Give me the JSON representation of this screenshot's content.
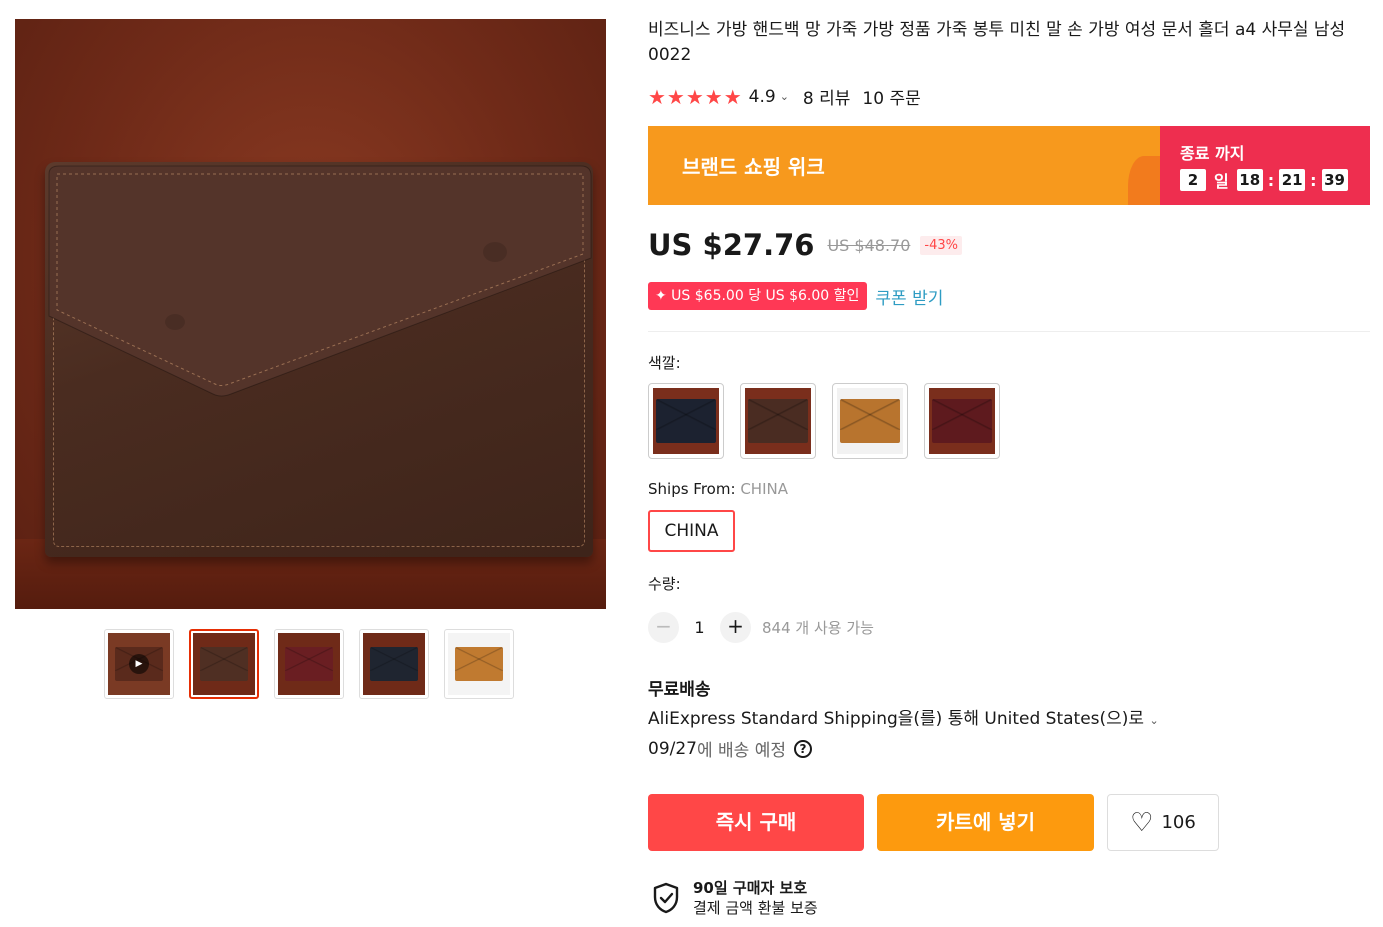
{
  "gallery": {
    "main_image_alt": "brown leather envelope document holder",
    "thumbnails": [
      {
        "name": "video",
        "color": "#7a3a24",
        "has_play": true
      },
      {
        "name": "brown",
        "color": "#4f2f23",
        "active": true
      },
      {
        "name": "wine",
        "color": "#6a1e22"
      },
      {
        "name": "navy",
        "color": "#1f2530"
      },
      {
        "name": "tan",
        "color": "#c07a30"
      }
    ],
    "play_icon": "▶"
  },
  "product": {
    "title": "비즈니스 가방 핸드백 망 가죽 가방 정품 가죽 봉투 미친 말 손 가방 여성 문서 홀더 a4 사무실 남성 0022",
    "stars": "★★★★★",
    "rating": "4.9",
    "rating_chevron": "⌄",
    "reviews": "8 리뷰",
    "orders": "10 주문"
  },
  "promo": {
    "label": "브랜드 쇼핑 위크",
    "timer_label": "종료 까지",
    "days": "2",
    "days_unit": "일",
    "hours": "18",
    "minutes": "21",
    "seconds": "39",
    "colon": ":"
  },
  "pricing": {
    "price": "US $27.76",
    "original_price": "US $48.70",
    "discount": "-43%",
    "coupon": "✦ US $65.00 당 US $6.00 할인",
    "coupon_action": "쿠폰 받기"
  },
  "options": {
    "color_label": "색깔:",
    "colors": [
      {
        "name": "navy",
        "hex": "#1c2230"
      },
      {
        "name": "brown",
        "hex": "#4a2c22"
      },
      {
        "name": "tan",
        "hex": "#b8742e"
      },
      {
        "name": "wine",
        "hex": "#5e1a1e"
      }
    ],
    "ships_from_label": "Ships From:",
    "ships_from_value": "CHINA",
    "ships_option": "CHINA",
    "quantity_label": "수량:",
    "qty_minus": "−",
    "qty_plus": "+",
    "quantity": "1",
    "available": "844 개 사용 가능"
  },
  "shipping": {
    "free": "무료배송",
    "method": "AliExpress Standard Shipping을(를) 통해 United States(으)로",
    "chevron": "⌄",
    "date": "09/27",
    "date_suffix": "에 배송 예정",
    "help_icon": "?"
  },
  "actions": {
    "buy_now": "즉시 구매",
    "add_to_cart": "카트에 넣기",
    "wishlist_icon": "♡",
    "wishlist_count": "106"
  },
  "protection": {
    "title": "90일 구매자 보호",
    "subtitle": "결제 금액 환불 보증"
  }
}
